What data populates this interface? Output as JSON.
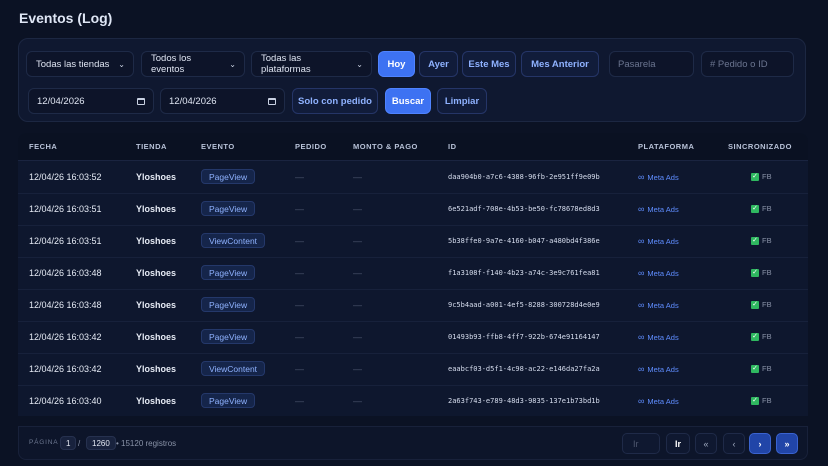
{
  "page": {
    "title": "Eventos (Log)"
  },
  "filters": {
    "store_select": "Todas las tiendas",
    "event_select": "Todos los eventos",
    "platform_select": "Todas las plataformas",
    "quick_ranges": {
      "today": "Hoy",
      "yesterday": "Ayer",
      "this_month": "Este Mes",
      "last_month": "Mes Anterior"
    },
    "active_range": "today",
    "gateway_placeholder": "Pasarela",
    "order_placeholder": "# Pedido o ID",
    "date_from": "12/04/2026",
    "date_to": "12/04/2026",
    "only_with_order": "Solo con pedido",
    "search": "Buscar",
    "clear": "Limpiar"
  },
  "table": {
    "columns": [
      "FECHA",
      "TIENDA",
      "EVENTO",
      "PEDIDO",
      "MONTO & PAGO",
      "ID",
      "PLATAFORMA",
      "SINCRONIZADO"
    ],
    "rows": [
      {
        "date": "12/04/26 16:03:52",
        "store": "Yloshoes",
        "event": "PageView",
        "order": "—",
        "amount": "—",
        "id": "daa904b0-a7c6-4388-96fb-2e951ff9e09b",
        "platform": "Meta Ads",
        "synced": "FB"
      },
      {
        "date": "12/04/26 16:03:51",
        "store": "Yloshoes",
        "event": "PageView",
        "order": "—",
        "amount": "—",
        "id": "6e521adf-708e-4b53-be50-fc78678ed8d3",
        "platform": "Meta Ads",
        "synced": "FB"
      },
      {
        "date": "12/04/26 16:03:51",
        "store": "Yloshoes",
        "event": "ViewContent",
        "order": "—",
        "amount": "—",
        "id": "5b38ffe0-9a7e-4160-b047-a480bd4f386e",
        "platform": "Meta Ads",
        "synced": "FB"
      },
      {
        "date": "12/04/26 16:03:48",
        "store": "Yloshoes",
        "event": "PageView",
        "order": "—",
        "amount": "—",
        "id": "f1a3108f-f140-4b23-a74c-3e9c761fea81",
        "platform": "Meta Ads",
        "synced": "FB"
      },
      {
        "date": "12/04/26 16:03:48",
        "store": "Yloshoes",
        "event": "PageView",
        "order": "—",
        "amount": "—",
        "id": "9c5b4aad-a001-4ef5-8288-300728d4e0e9",
        "platform": "Meta Ads",
        "synced": "FB"
      },
      {
        "date": "12/04/26 16:03:42",
        "store": "Yloshoes",
        "event": "PageView",
        "order": "—",
        "amount": "—",
        "id": "01493b93-ffb8-4ff7-922b-674e91164147",
        "platform": "Meta Ads",
        "synced": "FB"
      },
      {
        "date": "12/04/26 16:03:42",
        "store": "Yloshoes",
        "event": "ViewContent",
        "order": "—",
        "amount": "—",
        "id": "eaabcf03-d5f1-4c98-ac22-e146da27fa2a",
        "platform": "Meta Ads",
        "synced": "FB"
      },
      {
        "date": "12/04/26 16:03:40",
        "store": "Yloshoes",
        "event": "PageView",
        "order": "—",
        "amount": "—",
        "id": "2a63f743-e789-48d3-9835-137e1b73bd1b",
        "platform": "Meta Ads",
        "synced": "FB"
      }
    ]
  },
  "pagination": {
    "label": "PÁGINA",
    "current": "1",
    "separator": "/",
    "total": "1260",
    "records": "• 15120 registros",
    "goto_placeholder": "Ir",
    "goto_button": "Ir",
    "first": "«",
    "prev": "‹",
    "next": "›",
    "last": "»"
  },
  "icons": {
    "chevron": "chevron-down-icon",
    "calendar": "calendar-icon",
    "meta": "meta-infinity-icon",
    "check": "check-icon"
  },
  "colors": {
    "background": "#0b1224",
    "accent": "#3d72f2",
    "link": "#5f8dff",
    "success": "#2fb860"
  }
}
